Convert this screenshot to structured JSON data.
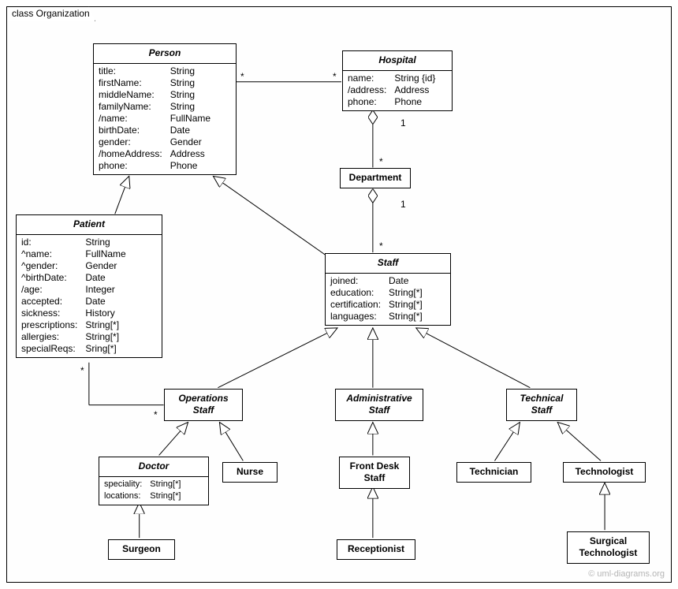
{
  "diagram": {
    "frame_label": "class Organization",
    "watermark": "© uml-diagrams.org"
  },
  "classes": {
    "person": {
      "title": "Person",
      "keys": "title:\nfirstName:\nmiddleName:\nfamilyName:\n/name:\nbirthDate:\ngender:\n/homeAddress:\nphone:",
      "types": "String\nString\nString\nString\nFullName\nDate\nGender\nAddress\nPhone"
    },
    "hospital": {
      "title": "Hospital",
      "keys": "name:\n/address:\nphone:",
      "types": "String {id}\nAddress\nPhone"
    },
    "department": {
      "title": "Department"
    },
    "patient": {
      "title": "Patient",
      "keys": "id:\n^name:\n^gender:\n^birthDate:\n/age:\naccepted:\nsickness:\nprescriptions:\nallergies:\nspecialReqs:",
      "types": "String\nFullName\nGender\nDate\nInteger\nDate\nHistory\nString[*]\nString[*]\nSring[*]"
    },
    "staff": {
      "title": "Staff",
      "keys": "joined:\neducation:\ncertification:\nlanguages:",
      "types": "Date\nString[*]\nString[*]\nString[*]"
    },
    "operations_staff": {
      "title": "Operations\nStaff"
    },
    "administrative_staff": {
      "title": "Administrative\nStaff"
    },
    "technical_staff": {
      "title": "Technical\nStaff"
    },
    "doctor": {
      "title": "Doctor",
      "keys": "speciality:\nlocations:",
      "types": "String[*]\nString[*]"
    },
    "nurse": {
      "title": "Nurse"
    },
    "front_desk": {
      "title": "Front Desk\nStaff"
    },
    "receptionist": {
      "title": "Receptionist"
    },
    "technician": {
      "title": "Technician"
    },
    "technologist": {
      "title": "Technologist"
    },
    "surgeon": {
      "title": "Surgeon"
    },
    "surgical_technologist": {
      "title": "Surgical\nTechnologist"
    }
  },
  "multiplicities": {
    "person_hosp_left": "*",
    "person_hosp_right": "*",
    "hosp_dept_top": "1",
    "hosp_dept_bot": "*",
    "dept_staff_top": "1",
    "dept_staff_bot": "*",
    "patient_ops_left": "*",
    "patient_ops_right": "*"
  }
}
